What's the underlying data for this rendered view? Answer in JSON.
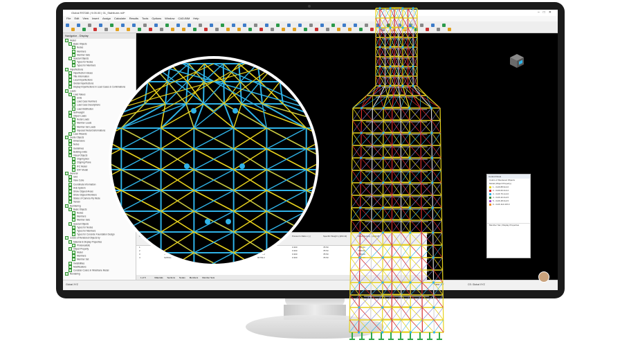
{
  "app": {
    "title": "Global RSTAB | 9.05.00 | 01_Stahlturm.rs9*",
    "menu": [
      "File",
      "Edit",
      "View",
      "Insert",
      "Assign",
      "Calculate",
      "Results",
      "Tools",
      "Options",
      "Window",
      "CAD-BIM",
      "Help"
    ],
    "license": "Online License 01 | Martin Hajek | Dlubal Software s.r.o."
  },
  "navigator": {
    "title": "Navigator - Display",
    "items": [
      "Model",
      "Basic Objects",
      "Nodes",
      "Members",
      "Member Sets",
      "Special Objects",
      "Types for Nodes",
      "Types for Members",
      "Imperfections",
      "Imperfection Values",
      "Title Information",
      "Local Imperfections",
      "Global Imperfections",
      "Display Imperfections in Load Cases & Combinations",
      "Loads",
      "Load Values",
      "Units",
      "Load Case Numbers",
      "Load Case Descriptions",
      "Load Distribution",
      "Self-weight",
      "Object Loads",
      "Nodal Loads",
      "Member Loads",
      "Member Set Loads",
      "Imposed Nodal Deformations",
      "Load Wizards",
      "Guide Objects",
      "Dimensions",
      "Notes",
      "Guidelines",
      "Building Grids",
      "Visual Objects",
      "Clipping Box",
      "Clipping Plane",
      "IFC Model",
      "DXF Model",
      "General",
      "Grid",
      "View Cube",
      "Coordinate Information",
      "Axis System",
      "Show Clipped Areas",
      "Show Clipped Members",
      "Status of Camera Fly Mode",
      "Terrain",
      "Numbering",
      "Basic Objects",
      "Nodes",
      "Members",
      "Member Sets",
      "Special Objects",
      "Types for Nodes",
      "Types for Members",
      "Types for Concrete Foundation Design",
      "Colors of Rendered Objects by",
      "Material & Display Properties",
      "Photorealistic",
      "Object Property",
      "Model",
      "Members",
      "Member Set",
      "Invisibilities",
      "Modifications",
      "Consider Colors in Wireframe Model",
      "Rendering"
    ]
  },
  "control_panel": {
    "title": "Control Panel",
    "subtitle": "Colors of Rendered Objects",
    "group": "Model (Object Property)",
    "rows": [
      {
        "label": "1 - CHS 88.9x4.0",
        "color": "#e8d21c"
      },
      {
        "label": "2 - CHS 60.3x3.2",
        "color": "#d62a2a"
      },
      {
        "label": "3 - CHS 76.1x4.0",
        "color": "#2fb3e8"
      },
      {
        "label": "4 - CHS 42.4x2.6",
        "color": "#3c8a3c"
      },
      {
        "label": "5 - CHS 48.3x2.6",
        "color": "#a04ad0"
      },
      {
        "label": "6 - CHS 114.3x5.0",
        "color": "#f08a1c"
      }
    ],
    "footer": "Member Set | Display Properties"
  },
  "table": {
    "headers": [
      "Material No.",
      "Material Name",
      "Modulus of Elasticity E [N/mm2]",
      "Shear Modulus G [N/mm2]",
      "Poisson's Ratio v [-]",
      "Specific Weight γ [kN/m3]",
      "Mass Density ρ [kg/m3]"
    ],
    "rows": [
      [
        "1",
        "S235",
        "210000.0",
        "80769.2",
        "0.300",
        "78.50",
        "7850.00"
      ],
      [
        "2",
        "S355",
        "210000.0",
        "80769.2",
        "0.300",
        "78.50",
        "7850.00"
      ],
      [
        "3",
        "S275",
        "210000.0",
        "80769.2",
        "0.300",
        "78.50",
        "7850.00"
      ],
      [
        "4",
        "S235JR",
        "210000.0",
        "80769.2",
        "0.300",
        "78.50",
        "7850.00"
      ]
    ],
    "pager": "1 of 5",
    "tabs": [
      "Materials",
      "Sections",
      "Nodes",
      "Members",
      "Member Sets"
    ]
  },
  "status": {
    "project": "Global XYZ",
    "plane": "Plane: XY",
    "cs": "CS: Global XYZ"
  },
  "colors": {
    "accent": "#2fb3e8",
    "yellow": "#e8d21c",
    "red": "#d62a2a",
    "green": "#2ea84a",
    "viewport_bg": "#000000"
  }
}
